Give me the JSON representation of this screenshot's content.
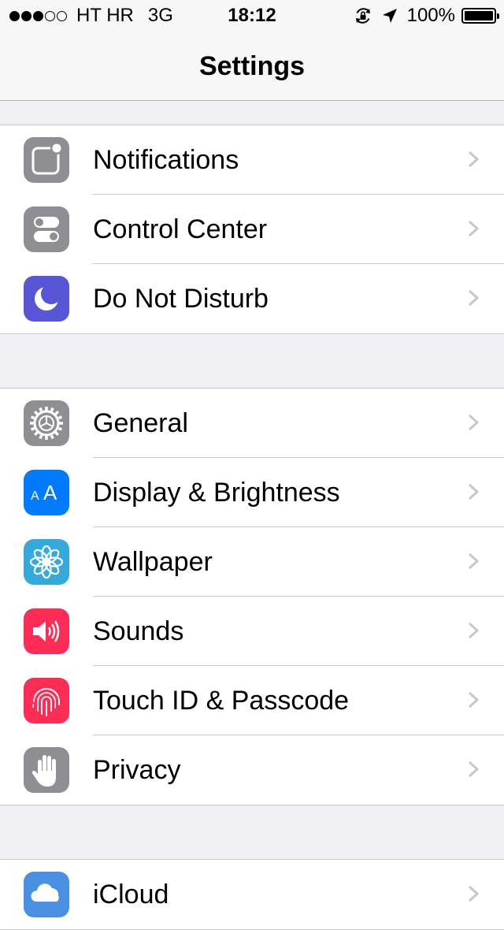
{
  "status_bar": {
    "carrier": "HT HR",
    "network": "3G",
    "time": "18:12",
    "battery_percent": "100%",
    "signal_bars_filled": 3,
    "signal_bars_total": 5
  },
  "nav": {
    "title": "Settings"
  },
  "groups": [
    {
      "items": [
        {
          "label": "Notifications",
          "icon": "notifications-icon",
          "color": "#8e8e93"
        },
        {
          "label": "Control Center",
          "icon": "control-center-icon",
          "color": "#8e8e93"
        },
        {
          "label": "Do Not Disturb",
          "icon": "moon-icon",
          "color": "#5856d6"
        }
      ]
    },
    {
      "items": [
        {
          "label": "General",
          "icon": "gear-icon",
          "color": "#8e8e93"
        },
        {
          "label": "Display & Brightness",
          "icon": "text-size-icon",
          "color": "#007aff"
        },
        {
          "label": "Wallpaper",
          "icon": "flower-icon",
          "color": "#34aadc"
        },
        {
          "label": "Sounds",
          "icon": "speaker-icon",
          "color": "#ff2d55"
        },
        {
          "label": "Touch ID & Passcode",
          "icon": "fingerprint-icon",
          "color": "#ff2d55"
        },
        {
          "label": "Privacy",
          "icon": "hand-icon",
          "color": "#8e8e93"
        }
      ]
    },
    {
      "items": [
        {
          "label": "iCloud",
          "icon": "cloud-icon",
          "color": "#4a90e2"
        }
      ]
    }
  ]
}
